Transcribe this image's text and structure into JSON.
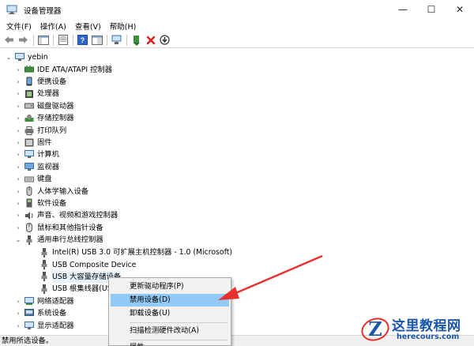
{
  "window": {
    "title": "设备管理器",
    "controls": {
      "minimize": "—",
      "maximize": "☐",
      "close": "✕"
    }
  },
  "menu": [
    "文件(F)",
    "操作(A)",
    "查看(V)",
    "帮助(H)"
  ],
  "toolbar_icons": [
    "back-icon",
    "forward-icon",
    "show-hide-console-tree-icon",
    "properties-icon",
    "help-icon",
    "scan-hardware-icon",
    "update-driver-icon",
    "disable-device-icon",
    "uninstall-device-icon",
    "enable-device-icon"
  ],
  "tree": {
    "root": "yebin",
    "items": [
      {
        "label": "IDE ATA/ATAPI 控制器",
        "icon": "ide-controller-icon",
        "expanded": false
      },
      {
        "label": "便携设备",
        "icon": "portable-device-icon",
        "expanded": false
      },
      {
        "label": "处理器",
        "icon": "processor-icon",
        "expanded": false
      },
      {
        "label": "磁盘驱动器",
        "icon": "disk-drive-icon",
        "expanded": false
      },
      {
        "label": "存储控制器",
        "icon": "storage-controller-icon",
        "expanded": false
      },
      {
        "label": "打印队列",
        "icon": "printer-icon",
        "expanded": false
      },
      {
        "label": "固件",
        "icon": "firmware-icon",
        "expanded": false
      },
      {
        "label": "计算机",
        "icon": "computer-icon",
        "expanded": false
      },
      {
        "label": "监视器",
        "icon": "monitor-icon",
        "expanded": false
      },
      {
        "label": "键盘",
        "icon": "keyboard-icon",
        "expanded": false
      },
      {
        "label": "人体学输入设备",
        "icon": "hid-icon",
        "expanded": false
      },
      {
        "label": "软件设备",
        "icon": "software-device-icon",
        "expanded": false
      },
      {
        "label": "声音、视频和游戏控制器",
        "icon": "sound-icon",
        "expanded": false
      },
      {
        "label": "鼠标和其他指针设备",
        "icon": "mouse-icon",
        "expanded": false
      },
      {
        "label": "通用串行总线控制器",
        "icon": "usb-controller-icon",
        "expanded": true
      }
    ],
    "usb_children": [
      {
        "label": "Intel(R) USB 3.0 可扩展主机控制器 - 1.0 (Microsoft)"
      },
      {
        "label": "USB Composite Device"
      },
      {
        "label": "USB 大容量存储设备",
        "selected": true
      },
      {
        "label": "USB 根集线器(US"
      }
    ],
    "after_items": [
      {
        "label": "网络适配器",
        "icon": "network-adapter-icon"
      },
      {
        "label": "系统设备",
        "icon": "system-device-icon"
      },
      {
        "label": "显示适配器",
        "icon": "display-adapter-icon"
      }
    ]
  },
  "context_menu": {
    "items": [
      "更新驱动程序(P)",
      "禁用设备(D)",
      "卸载设备(U)",
      "扫描检测硬件改动(A)",
      "属性"
    ],
    "highlighted": "禁用设备(D)"
  },
  "status": "禁用所选设备。",
  "watermark": {
    "title": "这里教程网",
    "url": "herecours.com"
  },
  "colors": {
    "highlight": "#91c9f7",
    "arrow": "#e8312f",
    "watermark": "#1b57a8"
  }
}
